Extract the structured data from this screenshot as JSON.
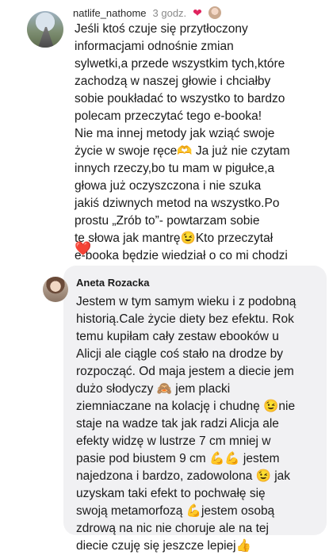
{
  "comment1": {
    "username": "natlife_nathome",
    "time": "3 godz.",
    "text": "Jeśli ktoś czuje się przytłoczony\ninformacjami odnośnie zmian\nsylwetki,a przede wszystkim tych,które\nzachodzą w naszej głowie i chciałby\nsobie poukładać to wszystko to bardzo\npolecam przeczytać tego e-booka!\nNie ma innej metody jak wziąć swoje\nżycie w swoje ręce🫶 Ja już nie czytam\ninnych rzeczy,bo tu mam w pigułce,a\ngłowa już oczyszczona i nie szuka\njakiś dziwnych metod na wszystko.Po\nprostu „Zrób to”- powtarzam sobie\nte słowa jak mantrę😉Kto przeczytał\ne-booka będzie wiedział o co mi chodzi",
    "heart": "❤️"
  },
  "comment2": {
    "author": "Aneta Rozacka",
    "text": "Jestem w tym samym wieku i z podobną\nhistorią.Cale życie diety bez efektu. Rok\ntemu kupiłam cały zestaw ebooków u\nAlicji ale ciągle coś stało na drodze by\nrozpocząć. Od maja jestem a diecie jem\ndużo słodyczy 🙈 jem placki\nziemniaczane na kolację i chudnę 😉nie\nstaje na wadze tak jak radzi Alicja ale\nefekty widzę w lustrze 7 cm mniej w\npasie pod biustem 9 cm 💪💪 jestem\nnajedzona i bardzo, zadowolona 😉 jak\nuzyskam taki efekt to pochwałę się\nswoją metamorfozą 💪jestem osobą\nzdrową na nic nie choruje ale na tej\ndiecie czuję się jeszcze lepiej👍"
  }
}
